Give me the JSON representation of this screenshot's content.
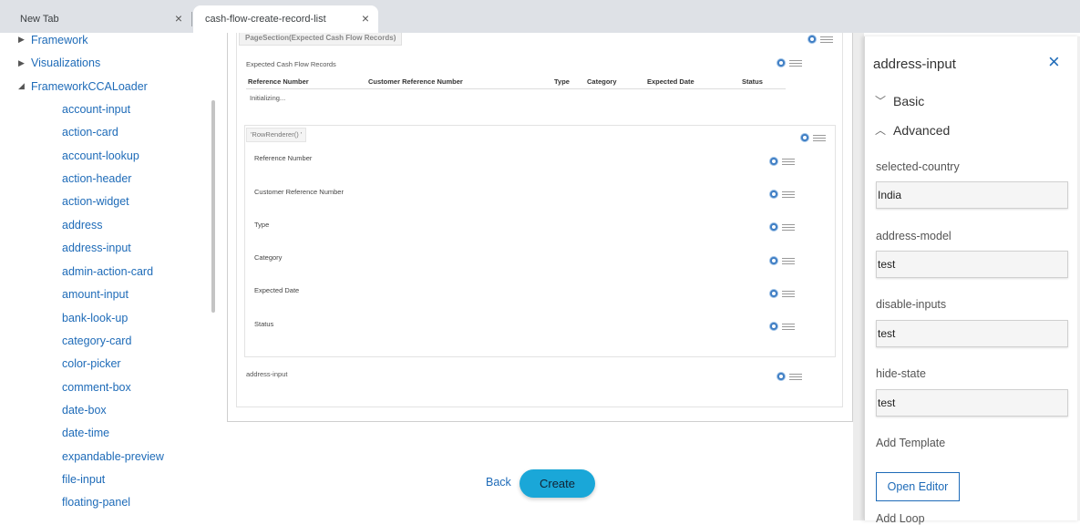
{
  "browser": {
    "tabs": [
      {
        "title": "New Tab",
        "close": "×"
      },
      {
        "title": "cash-flow-create-record-list",
        "close": "×"
      }
    ]
  },
  "tree": {
    "nodes": [
      {
        "label": "Framework",
        "caret": "▶"
      },
      {
        "label": "Visualizations",
        "caret": "▶"
      },
      {
        "label": "FrameworkCCALoader",
        "caret": "◢"
      }
    ],
    "leaves": [
      "account-input",
      "action-card",
      "account-lookup",
      "action-header",
      "action-widget",
      "address",
      "address-input",
      "admin-action-card",
      "amount-input",
      "bank-look-up",
      "category-card",
      "color-picker",
      "comment-box",
      "date-box",
      "date-time",
      "expandable-preview",
      "file-input",
      "floating-panel"
    ]
  },
  "canvas": {
    "page_section_tag": "PageSection(Expected Cash Flow Records)",
    "table_caption": "Expected Cash Flow Records",
    "columns": [
      "Reference Number",
      "Customer Reference Number",
      "Type",
      "Category",
      "Expected Date",
      "Status"
    ],
    "initializing_text": "Initializing...",
    "row_renderer_tag": "'RowRenderer() '",
    "row_fields": [
      "Reference Number",
      "Customer Reference Number",
      "Type",
      "Category",
      "Expected Date",
      "Status"
    ],
    "address_component": "address-input",
    "back_label": "Back",
    "create_label": "Create"
  },
  "props": {
    "title": "address-input",
    "close_icon": "×",
    "sections": [
      {
        "label": "Basic",
        "chevron": "﹀"
      },
      {
        "label": "Advanced",
        "chevron": "︿"
      }
    ],
    "fields": [
      {
        "label": "selected-country",
        "value": "India"
      },
      {
        "label": "address-model",
        "value": "test"
      },
      {
        "label": "disable-inputs",
        "value": "test"
      },
      {
        "label": "hide-state",
        "value": "test"
      }
    ],
    "add_template_label": "Add Template",
    "open_editor_label": "Open Editor",
    "add_loop_label": "Add Loop"
  },
  "colors": {
    "accent": "#1e6bb8",
    "create_button": "#1aa7d8"
  }
}
